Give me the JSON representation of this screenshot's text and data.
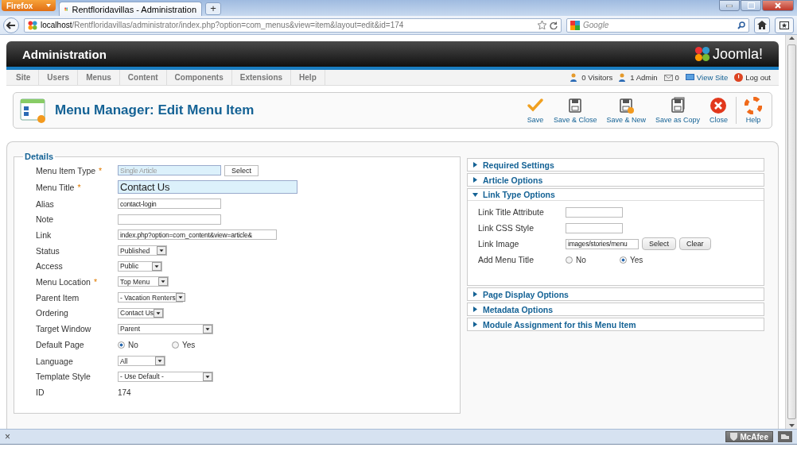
{
  "browser": {
    "menu_button": "Firefox",
    "tab_title": "Rentfloridavillas - Administration",
    "new_tab": "+",
    "url_host": "localhost",
    "url_path": "/Rentfloridavillas/administrator/index.php?option=com_menus&view=item&layout=edit&id=174",
    "search_placeholder": "Google"
  },
  "header": {
    "title": "Administration",
    "logo": "Joomla!"
  },
  "menu": [
    "Site",
    "Users",
    "Menus",
    "Content",
    "Components",
    "Extensions",
    "Help"
  ],
  "status": [
    {
      "kind": "visitors",
      "label": "0 Visitors"
    },
    {
      "kind": "admin",
      "label": "1 Admin"
    },
    {
      "kind": "messages",
      "label": "0"
    },
    {
      "kind": "view",
      "label": "View Site"
    },
    {
      "kind": "logout",
      "label": "Log out"
    }
  ],
  "page_title": "Menu Manager: Edit Menu Item",
  "toolbar": [
    {
      "kind": "save",
      "label": "Save"
    },
    {
      "kind": "save_close",
      "label": "Save & Close"
    },
    {
      "kind": "save_new",
      "label": "Save & New"
    },
    {
      "kind": "save_copy",
      "label": "Save as Copy"
    },
    {
      "kind": "close",
      "label": "Close"
    },
    {
      "kind": "help",
      "label": "Help"
    }
  ],
  "details": {
    "legend": "Details",
    "fields": [
      {
        "label": "Menu Item Type",
        "mark": "*",
        "kind": "type",
        "value": "Single Article",
        "button": "Select"
      },
      {
        "label": "Menu Title",
        "mark": "*",
        "kind": "title",
        "value": "Contact Us"
      },
      {
        "label": "Alias",
        "kind": "text",
        "value": "contact-login"
      },
      {
        "label": "Note",
        "kind": "text"
      },
      {
        "label": "Link",
        "kind": "text",
        "value": "index.php?option=com_content&view=article&"
      },
      {
        "label": "Status",
        "kind": "select",
        "value": "Published"
      },
      {
        "label": "Access",
        "kind": "select",
        "value": "Public"
      },
      {
        "label": "Menu Location",
        "mark": "*",
        "kind": "select",
        "value": "Top Menu"
      },
      {
        "label": "Parent Item",
        "kind": "select",
        "value": "- Vacation Renters"
      },
      {
        "label": "Ordering",
        "kind": "select",
        "value": "Contact Us"
      },
      {
        "label": "Target Window",
        "kind": "select",
        "value": "Parent"
      },
      {
        "label": "Default Page",
        "kind": "radio",
        "options": [
          {
            "label": "No",
            "selected": true
          },
          {
            "label": "Yes",
            "selected": false
          }
        ]
      },
      {
        "label": "Language",
        "kind": "select",
        "value": "All"
      },
      {
        "label": "Template Style",
        "kind": "select",
        "value": "- Use Default -"
      },
      {
        "label": "ID",
        "kind": "value",
        "value": "174"
      }
    ]
  },
  "panels": [
    {
      "title": "Required Settings",
      "expanded": false
    },
    {
      "title": "Article Options",
      "expanded": false
    },
    {
      "title": "Link Type Options",
      "expanded": true,
      "fields": [
        {
          "label": "Link Title Attribute",
          "kind": "text"
        },
        {
          "label": "Link CSS Style",
          "kind": "text"
        },
        {
          "label": "Link Image",
          "kind": "image",
          "value": "images/stories/menu",
          "buttons": [
            "Select",
            "Clear"
          ]
        },
        {
          "label": "Add Menu Title",
          "kind": "radio",
          "options": [
            {
              "label": "No",
              "selected": false
            },
            {
              "label": "Yes",
              "selected": true
            }
          ]
        }
      ]
    },
    {
      "title": "Page Display Options",
      "expanded": false
    },
    {
      "title": "Metadata Options",
      "expanded": false
    },
    {
      "title": "Module Assignment for this Menu Item",
      "expanded": false
    }
  ],
  "status_bar": {
    "close": "×",
    "addon": "McAfee"
  }
}
